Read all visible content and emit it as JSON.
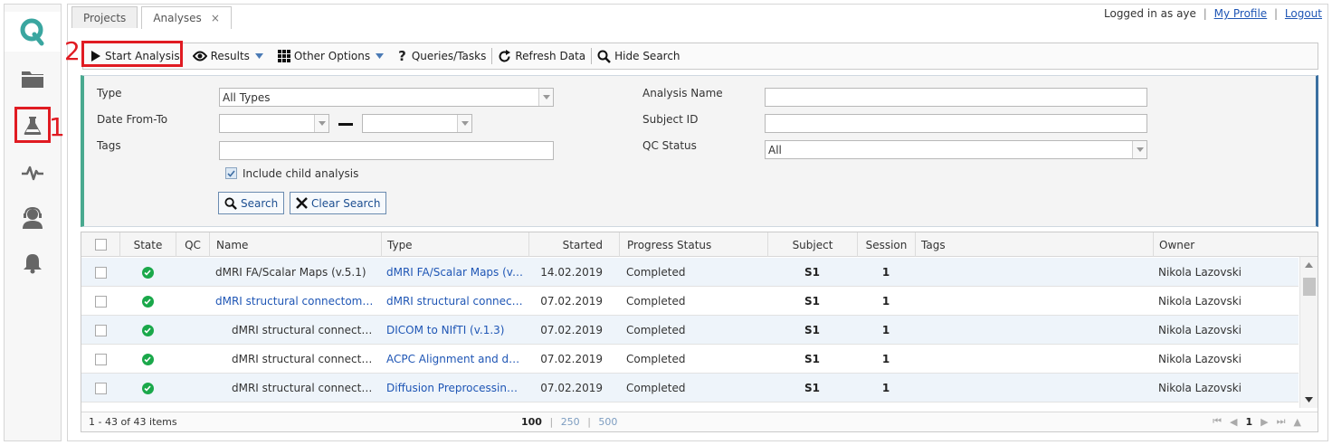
{
  "sidebar": {
    "items": [
      {
        "name": "logo",
        "icon": "q-logo-icon"
      },
      {
        "name": "projects",
        "icon": "folder-icon"
      },
      {
        "name": "analyses",
        "icon": "flask-icon"
      },
      {
        "name": "activity",
        "icon": "pulse-icon"
      },
      {
        "name": "support",
        "icon": "headset-user-icon"
      },
      {
        "name": "notifications",
        "icon": "bell-icon"
      }
    ],
    "callout_number": "1"
  },
  "tabs": [
    {
      "label": "Projects"
    },
    {
      "label": "Analyses",
      "close": "×"
    }
  ],
  "header": {
    "logged_in_prefix": "Logged in as",
    "username": "aye",
    "my_profile": "My Profile",
    "logout": "Logout",
    "separator": "|"
  },
  "toolbar": {
    "callout_number": "2",
    "start_analysis": "Start Analysis",
    "results": "Results",
    "other_options": "Other Options",
    "queries_tasks": "Queries/Tasks",
    "refresh_data": "Refresh Data",
    "hide_search": "Hide Search"
  },
  "search": {
    "type_label": "Type",
    "type_value": "All Types",
    "date_label": "Date From-To",
    "date_from": "",
    "date_to": "",
    "tags_label": "Tags",
    "tags_value": "",
    "include_child_label": "Include child analysis",
    "include_child_checked": true,
    "analysis_name_label": "Analysis Name",
    "analysis_name_value": "",
    "subject_id_label": "Subject ID",
    "subject_id_value": "",
    "qc_status_label": "QC Status",
    "qc_status_value": "All",
    "search_button": "Search",
    "clear_button": "Clear Search"
  },
  "grid": {
    "columns": [
      "State",
      "QC",
      "Name",
      "Type",
      "Started",
      "Progress Status",
      "Subject",
      "Session",
      "Tags",
      "Owner"
    ],
    "rows": [
      {
        "name": "dMRI FA/Scalar Maps (v.5.1)",
        "type": "dMRI FA/Scalar Maps (v.5...",
        "started": "14.02.2019",
        "status": "Completed",
        "subject": "S1",
        "session": "1",
        "tags": "",
        "owner": "Nikola Lazovski"
      },
      {
        "name": "dMRI structural connectome (...",
        "type": "dMRI structural connect...",
        "started": "07.02.2019",
        "status": "Completed",
        "subject": "S1",
        "session": "1",
        "tags": "",
        "owner": "Nikola Lazovski"
      },
      {
        "name": "dMRI structural connecto...",
        "type": "DICOM to NIfTI (v.1.3)",
        "started": "07.02.2019",
        "status": "Completed",
        "subject": "S1",
        "session": "1",
        "tags": "",
        "owner": "Nikola Lazovski"
      },
      {
        "name": "dMRI structural connecto...",
        "type": "ACPC Alignment and defa...",
        "started": "07.02.2019",
        "status": "Completed",
        "subject": "S1",
        "session": "1",
        "tags": "",
        "owner": "Nikola Lazovski"
      },
      {
        "name": "dMRI structural connecto...",
        "type": "Diffusion Preprocessing ...",
        "started": "07.02.2019",
        "status": "Completed",
        "subject": "S1",
        "session": "1",
        "tags": "",
        "owner": "Nikola Lazovski"
      }
    ],
    "pager": {
      "items_text": "1 - 43 of 43 items",
      "page_size_current": "100",
      "page_size_250": "250",
      "page_size_500": "500",
      "separator": "|",
      "page": "1"
    }
  },
  "colors": {
    "accent_red": "#e01b22",
    "link": "#1f56b5",
    "success": "#1aa84a",
    "teal": "#49a98f"
  }
}
